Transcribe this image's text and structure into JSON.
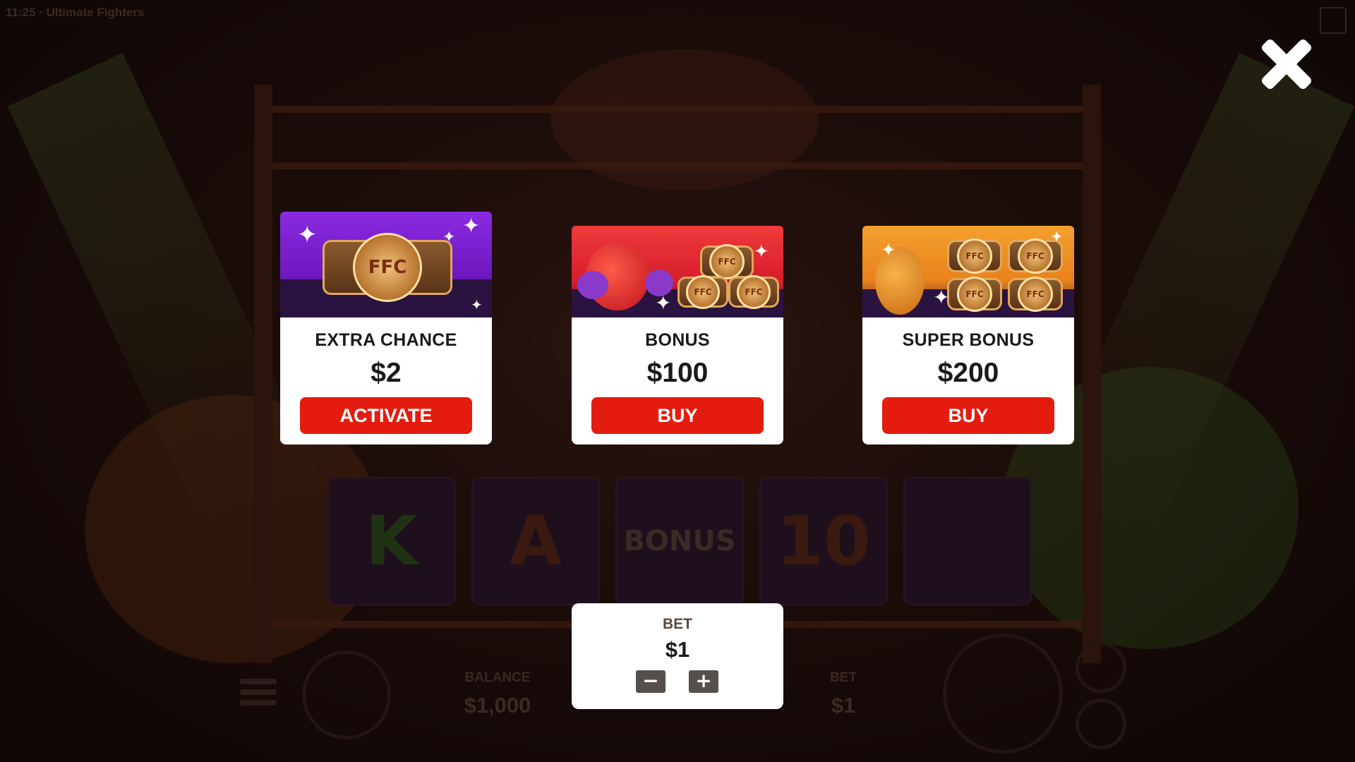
{
  "app": {
    "title": "11:25 · Ultimate Fighters"
  },
  "background": {
    "balance_label": "BALANCE",
    "balance_value": "$1,000",
    "bet_label": "BET",
    "bet_value": "$1",
    "reel_symbols": [
      "K",
      "A",
      "BONUS",
      "10",
      ""
    ]
  },
  "close": {
    "icon": "close-icon"
  },
  "offers": [
    {
      "name": "EXTRA CHANCE",
      "price": "$2",
      "action": "ACTIVATE",
      "theme": "#7b22d0"
    },
    {
      "name": "BONUS",
      "price": "$100",
      "action": "BUY",
      "theme": "#e8283a"
    },
    {
      "name": "SUPER BONUS",
      "price": "$200",
      "action": "BUY",
      "theme": "#f0921f"
    }
  ],
  "bet_panel": {
    "label": "BET",
    "value": "$1",
    "minus": "−",
    "plus": "+"
  },
  "colors": {
    "action_button": "#e41c0f",
    "panel": "#ffffff",
    "stepper": "#55504c"
  },
  "art_text": {
    "belt": "FFC"
  }
}
